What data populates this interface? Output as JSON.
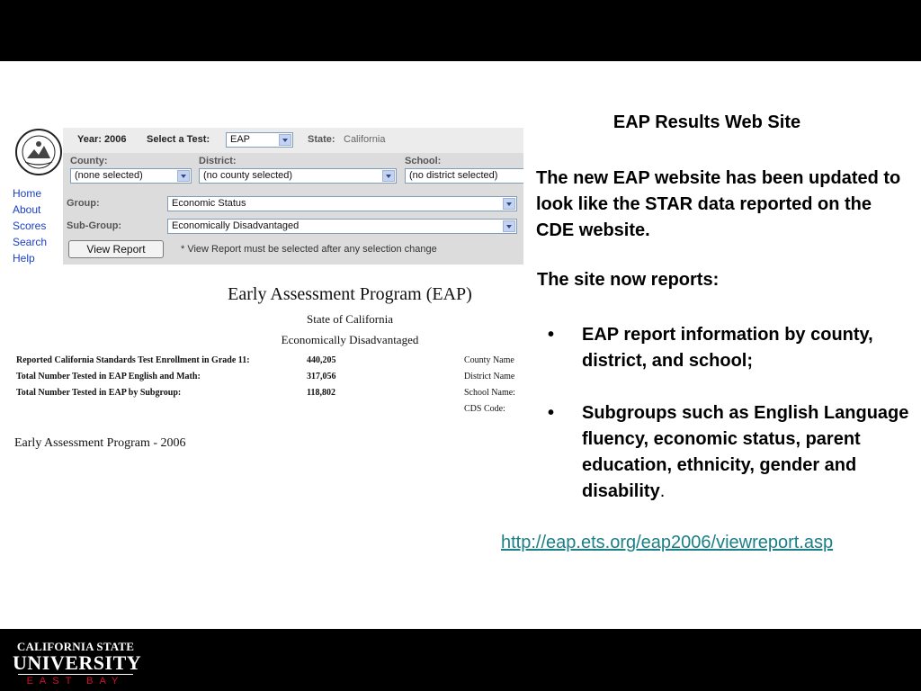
{
  "slide": {
    "heading": "EAP Results Web Site",
    "intro": "The new EAP website has been updated to look like the STAR data reported on the CDE website.",
    "subheading": "The site now reports:",
    "bullets": [
      {
        "text": "EAP report information by county, district, and school;",
        "suffix": ""
      },
      {
        "text": "Subgroups such as English Language fluency, economic status, parent education, ethnicity, gender and disability",
        "suffix": "."
      }
    ],
    "url": "http://eap.ets.org/eap2006/viewreport.asp"
  },
  "logo": {
    "line1": "CALIFORNIA STATE",
    "line2": "UNIVERSITY",
    "line3": "EAST BAY"
  },
  "screenshot": {
    "nav": [
      "Home",
      "About",
      "Scores",
      "Search",
      "Help"
    ],
    "form": {
      "year_label": "Year: 2006",
      "test_label": "Select a Test:",
      "test_value": "EAP",
      "state_label": "State:",
      "state_value": "California",
      "county_label": "County:",
      "county_value": "(none selected)",
      "district_label": "District:",
      "district_value": "(no county selected)",
      "school_label": "School:",
      "school_value": "(no district selected)",
      "group_label": "Group:",
      "group_value": "Economic Status",
      "subgroup_label": "Sub-Group:",
      "subgroup_value": "Economically Disadvantaged",
      "view_report": "View Report",
      "note": "* View Report must be selected after any selection change"
    },
    "report": {
      "title": "Early Assessment Program (EAP)",
      "state": "State of California",
      "subgroup": "Economically Disadvantaged",
      "stats": [
        {
          "label": "Reported California Standards Test Enrollment in Grade 11:",
          "value": "440,205"
        },
        {
          "label": "Total Number Tested in EAP English and Math:",
          "value": "317,056"
        },
        {
          "label": "Total Number Tested in EAP by Subgroup:",
          "value": "118,802"
        }
      ],
      "side_labels": [
        "County Name",
        "District Name",
        "School Name:",
        "CDS Code:"
      ],
      "footer": "Early Assessment Program - 2006"
    }
  }
}
